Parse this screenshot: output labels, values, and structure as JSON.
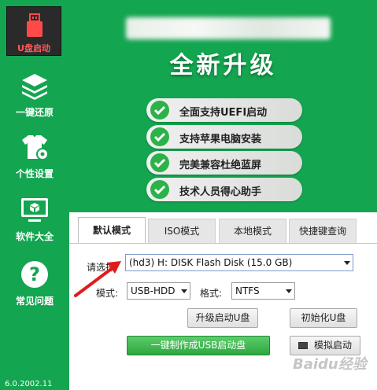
{
  "sidebar": {
    "logo_label": "U盘启动",
    "items": [
      {
        "label": "一键还原",
        "icon": "layers-icon"
      },
      {
        "label": "个性设置",
        "icon": "tshirt-gear-icon"
      },
      {
        "label": "软件大全",
        "icon": "monitor-box-icon"
      },
      {
        "label": "常见问题",
        "icon": "question-icon"
      }
    ],
    "version": "6.0.2002.11"
  },
  "header": {
    "upgrade_title": "全新升级",
    "features": [
      "全面支持UEFI启动",
      "支持苹果电脑安装",
      "完美兼容杜绝蓝屏",
      "技术人员得心助手"
    ]
  },
  "tabs": [
    "默认模式",
    "ISO模式",
    "本地模式",
    "快捷键查询"
  ],
  "form": {
    "select_label": "请选择:",
    "disk_value": "(hd3) H: DISK Flash Disk (15.0 GB)",
    "mode_label": "模式:",
    "mode_value": "USB-HDD",
    "format_label": "格式:",
    "format_value": "NTFS"
  },
  "buttons": {
    "upgrade": "升级启动U盘",
    "init": "初始化U盘",
    "make": "一键制作成USB启动盘",
    "simulate": "模拟启动"
  },
  "watermark": "Baidu经验",
  "colors": {
    "brand_green": "#14a550",
    "logo_red": "#ff5a5a",
    "arrow_red": "#e01b1b"
  }
}
